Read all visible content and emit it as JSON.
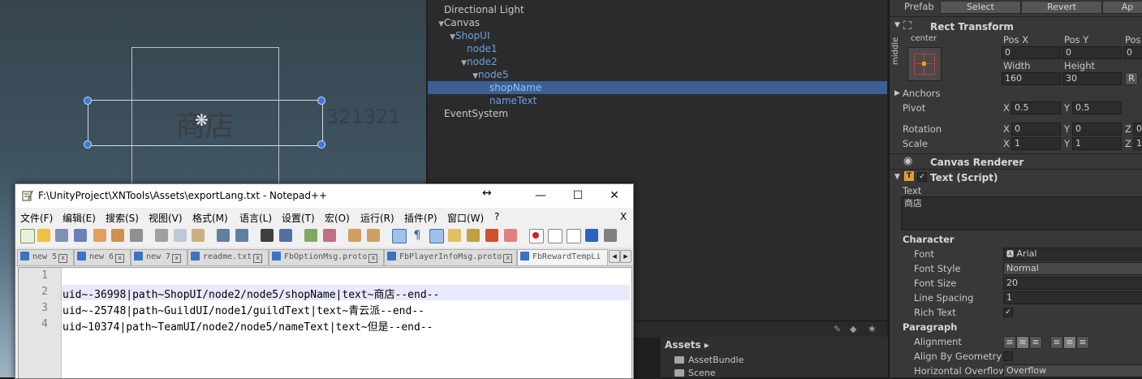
{
  "scene": {
    "shop_label": "商店",
    "number_label": "321321"
  },
  "hierarchy": {
    "items": [
      {
        "label": "Directional Light",
        "indent": 0,
        "arrow": "",
        "blue": false,
        "selected": false
      },
      {
        "label": "Canvas",
        "indent": 0,
        "arrow": "▼",
        "blue": false,
        "selected": false
      },
      {
        "label": "ShopUI",
        "indent": 1,
        "arrow": "▼",
        "blue": true,
        "selected": false
      },
      {
        "label": "node1",
        "indent": 2,
        "arrow": "",
        "blue": true,
        "selected": false
      },
      {
        "label": "node2",
        "indent": 2,
        "arrow": "▼",
        "blue": true,
        "selected": false
      },
      {
        "label": "node5",
        "indent": 3,
        "arrow": "▼",
        "blue": true,
        "selected": false
      },
      {
        "label": "shopName",
        "indent": 4,
        "arrow": "",
        "blue": true,
        "selected": true
      },
      {
        "label": "nameText",
        "indent": 4,
        "arrow": "",
        "blue": true,
        "selected": false
      },
      {
        "label": "EventSystem",
        "indent": 0,
        "arrow": "",
        "blue": false,
        "selected": false
      }
    ]
  },
  "project": {
    "assets_header": "Assets ▸",
    "folders": [
      "AssetBundle",
      "Scene"
    ]
  },
  "inspector": {
    "prefab_label": "Prefab",
    "prefab_select": "Select",
    "prefab_revert": "Revert",
    "prefab_apply": "Ap",
    "rect_transform_title": "Rect Transform",
    "anchor_h": "center",
    "anchor_v": "middle",
    "pos_x_label": "Pos X",
    "pos_y_label": "Pos Y",
    "pos_z_label": "Pos",
    "pos_x": "0",
    "pos_y": "0",
    "pos_z": "0",
    "width_label": "Width",
    "height_label": "Height",
    "width": "160",
    "height": "30",
    "anchors_label": "Anchors",
    "pivot_label": "Pivot",
    "pivot_x": "0.5",
    "pivot_y": "0.5",
    "rotation_label": "Rotation",
    "rot_x": "0",
    "rot_y": "0",
    "rot_z": "0",
    "scale_label": "Scale",
    "scale_x": "1",
    "scale_y": "1",
    "scale_z": "1",
    "x": "X",
    "y": "Y",
    "z": "Z",
    "canvas_renderer_title": "Canvas Renderer",
    "text_script_title": "Text (Script)",
    "text_label": "Text",
    "text_value": "商店",
    "character_label": "Character",
    "font_label": "Font",
    "font_value": "Arial",
    "font_style_label": "Font Style",
    "font_style_value": "Normal",
    "font_size_label": "Font Size",
    "font_size_value": "20",
    "line_spacing_label": "Line Spacing",
    "line_spacing_value": "1",
    "rich_text_label": "Rich Text",
    "paragraph_label": "Paragraph",
    "alignment_label": "Alignment",
    "align_geometry_label": "Align By Geometry",
    "horiz_overflow_label": "Horizontal Overflow",
    "horiz_overflow_value": "Overflow"
  },
  "notepad": {
    "title": "F:\\UnityProject\\XNTools\\Assets\\exportLang.txt - Notepad++",
    "menus": [
      "文件(F)",
      "编辑(E)",
      "搜索(S)",
      "视图(V)",
      "格式(M)",
      "语言(L)",
      "设置(T)",
      "宏(O)",
      "运行(R)",
      "插件(P)",
      "窗口(W)",
      "?"
    ],
    "menu_close": "X",
    "tabs": [
      "new 5",
      "new 6",
      "new 7",
      "readme.txt",
      "FbOptionMsg.proto",
      "FbPlayerInfoMsg.proto",
      "FbRewardTempLi"
    ],
    "lines": [
      {
        "num": "1",
        "text": ""
      },
      {
        "num": "2",
        "text": "uid~-36998|path~ShopUI/node2/node5/shopName|text~商店--end--"
      },
      {
        "num": "3",
        "text": "uid~-25748|path~GuildUI/node1/guildText|text~青云派--end--"
      },
      {
        "num": "4",
        "text": "uid~10374|path~TeamUI/node2/node5/nameText|text~但是--end--"
      }
    ],
    "win_minimize": "—",
    "win_maximize": "☐",
    "win_close": "✕",
    "resize_cursor": "↔"
  }
}
